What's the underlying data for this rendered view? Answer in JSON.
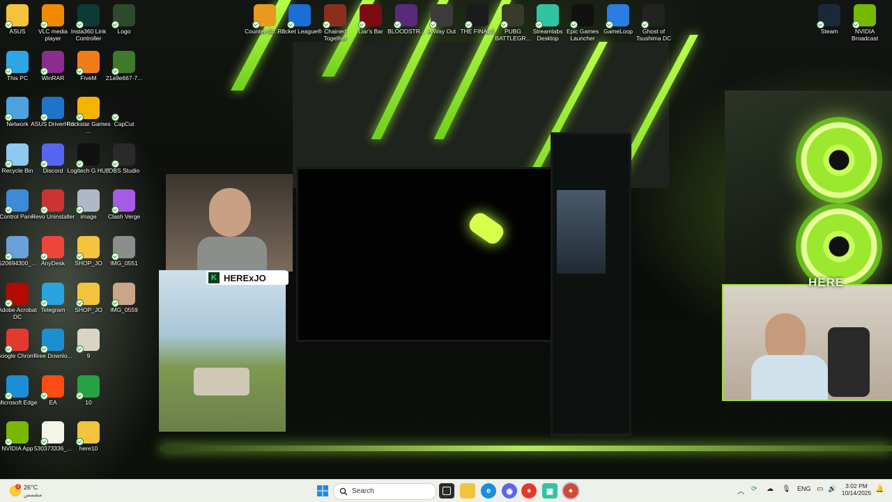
{
  "desktop_icons": [
    {
      "label": "ASUS",
      "icon": "folder-icon",
      "color": "#f3c33d"
    },
    {
      "label": "This PC",
      "icon": "monitor-icon",
      "color": "#2ea6e6"
    },
    {
      "label": "Network",
      "icon": "network-icon",
      "color": "#4aa3e0"
    },
    {
      "label": "Recycle Bin",
      "icon": "recycle-bin-icon",
      "color": "#8ec9ef"
    },
    {
      "label": "Control Panel",
      "icon": "control-panel-icon",
      "color": "#3d8ad8"
    },
    {
      "label": "520694300_...",
      "icon": "image-file-icon",
      "color": "#6aa0d8"
    },
    {
      "label": "Adobe Acrobat DC",
      "icon": "acrobat-icon",
      "color": "#b30b00"
    },
    {
      "label": "Google Chrome",
      "icon": "chrome-icon",
      "color": "#e5392f"
    },
    {
      "label": "Microsoft Edge",
      "icon": "edge-icon",
      "color": "#1a8fd8"
    },
    {
      "label": "NVIDIA App",
      "icon": "nvidia-icon",
      "color": "#76b900"
    },
    {
      "label": "VLC media player",
      "icon": "vlc-icon",
      "color": "#f08a00"
    },
    {
      "label": "WinRAR",
      "icon": "winrar-icon",
      "color": "#8b2c8f"
    },
    {
      "label": "ASUS DriverHub",
      "icon": "gear-icon",
      "color": "#1e74c8"
    },
    {
      "label": "Discord",
      "icon": "discord-icon",
      "color": "#5865f2"
    },
    {
      "label": "Revo Uninstaller",
      "icon": "revo-icon",
      "color": "#c33"
    },
    {
      "label": "AnyDesk",
      "icon": "anydesk-icon",
      "color": "#ef443b"
    },
    {
      "label": "Telegram",
      "icon": "telegram-icon",
      "color": "#2aa3de"
    },
    {
      "label": "Free Downlo...",
      "icon": "download-icon",
      "color": "#1c8fd3"
    },
    {
      "label": "EA",
      "icon": "ea-icon",
      "color": "#ff4a14"
    },
    {
      "label": "530373336_...",
      "icon": "image-file-icon",
      "color": "#f4f4e8"
    },
    {
      "label": "Insta360 Link Controller",
      "icon": "insta360-icon",
      "color": "#0c3b35"
    },
    {
      "label": "FiveM",
      "icon": "fivem-icon",
      "color": "#f07c1a"
    },
    {
      "label": "Rockstar Games ...",
      "icon": "rockstar-icon",
      "color": "#f4b300"
    },
    {
      "label": "Logitech G HUB",
      "icon": "logitech-icon",
      "color": "#111"
    },
    {
      "label": "image",
      "icon": "image-file-icon",
      "color": "#b0b8c8"
    },
    {
      "label": "SHOP_JO",
      "icon": "folder-icon",
      "color": "#f3c33d"
    },
    {
      "label": "SHOP_JO",
      "icon": "folder-icon",
      "color": "#f3c33d"
    },
    {
      "label": "9",
      "icon": "image-file-icon",
      "color": "#d9d4c4"
    },
    {
      "label": "10",
      "icon": "whatsapp-icon",
      "color": "#25a244"
    },
    {
      "label": "here10",
      "icon": "folder-icon",
      "color": "#f3c33d"
    },
    {
      "label": "Logo",
      "icon": "logo-file-icon",
      "color": "#2d4a2d"
    },
    {
      "label": "21a9e667-7...",
      "icon": "image-file-icon",
      "color": "#3f7a2a"
    },
    {
      "label": "CapCut",
      "icon": "capcut-icon",
      "color": "#111"
    },
    {
      "label": "OBS Studio",
      "icon": "obs-icon",
      "color": "#2a2a2a"
    },
    {
      "label": "Clash Verge",
      "icon": "clash-icon",
      "color": "#a65ae8"
    },
    {
      "label": "IMG_0551",
      "icon": "image-file-icon",
      "color": "#8d8d8d"
    },
    {
      "label": "IMG_0559",
      "icon": "image-file-icon",
      "color": "#c9a58a"
    }
  ],
  "top_icons": [
    {
      "label": "Counter-Str... 2",
      "icon": "counter-strike-icon",
      "color": "#e89a1e"
    },
    {
      "label": "Rocket League®",
      "icon": "rocket-league-icon",
      "color": "#1a6fd6"
    },
    {
      "label": "Chained Together",
      "icon": "chained-together-icon",
      "color": "#8a2f1e"
    },
    {
      "label": "Liar's Bar",
      "icon": "liars-bar-icon",
      "color": "#7a0c12"
    },
    {
      "label": "BLOODSTR...",
      "icon": "bloodstrike-icon",
      "color": "#5a2a7a"
    },
    {
      "label": "A Way Out",
      "icon": "a-way-out-icon",
      "color": "#3b3b3b"
    },
    {
      "label": "THE FINALS",
      "icon": "the-finals-icon",
      "color": "#1b1b1b"
    },
    {
      "label": "PUBG BATTLEGR...",
      "icon": "pubg-icon",
      "color": "#3a3a2a"
    },
    {
      "label": "Streamlabs Desktop",
      "icon": "streamlabs-icon",
      "color": "#31c3a2"
    },
    {
      "label": "Epic Games Launcher",
      "icon": "epic-games-icon",
      "color": "#111"
    },
    {
      "label": "GameLoop",
      "icon": "gameloop-icon",
      "color": "#2a7de1"
    },
    {
      "label": "Ghost of Tsushima DC",
      "icon": "ghost-of-tsushima-icon",
      "color": "#222"
    },
    {
      "label": "Steam",
      "icon": "steam-icon",
      "color": "#1b2838"
    },
    {
      "label": "NVIDIA Broadcast",
      "icon": "nvidia-broadcast-icon",
      "color": "#76b900"
    }
  ],
  "stream_overlay": {
    "nameplate": "HERExJO",
    "cam_label": "HERE"
  },
  "taskbar": {
    "weather_temp": "26°C",
    "weather_desc": "مشمس",
    "search_placeholder": "Search",
    "language": "ENG",
    "time": "3:02 PM",
    "date": "10/14/2025"
  }
}
